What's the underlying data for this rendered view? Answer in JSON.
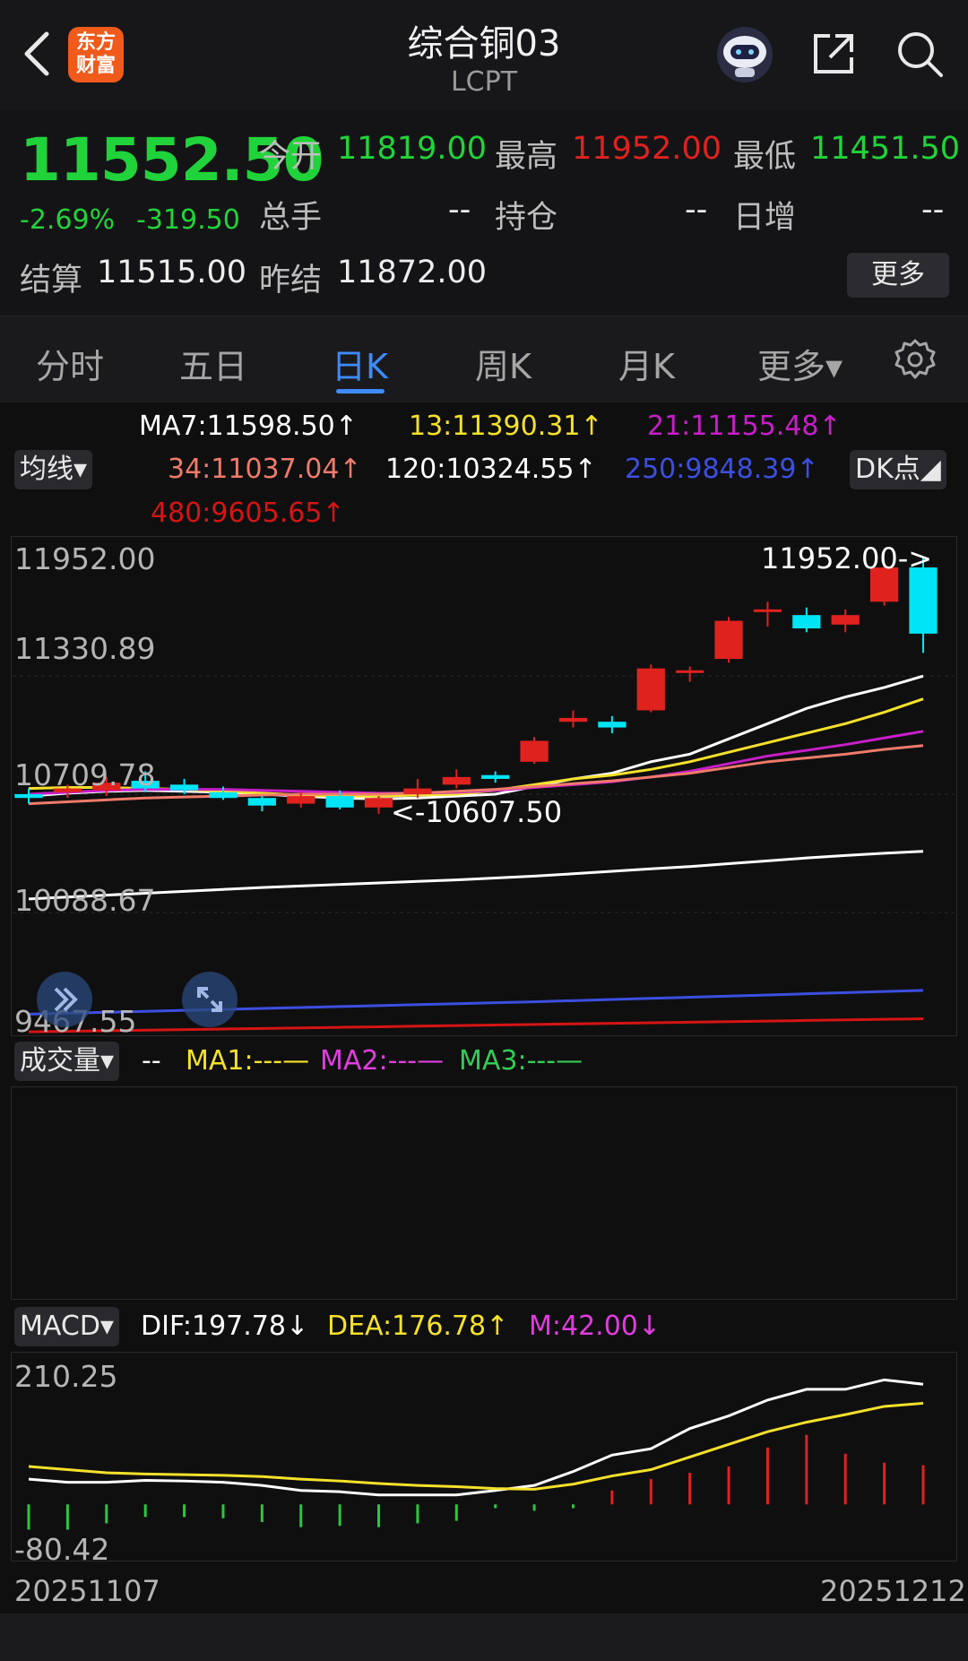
{
  "header": {
    "logo_top": "东方",
    "logo_bottom": "财富",
    "title": "综合铜03",
    "subtitle": "LCPT"
  },
  "quote": {
    "price": "11552.50",
    "change_pct": "-2.69%",
    "change_abs": "-319.50",
    "open_label": "今开",
    "open": "11819.00",
    "high_label": "最高",
    "high": "11952.00",
    "low_label": "最低",
    "low": "11451.50",
    "volume_label": "总手",
    "volume": "--",
    "oi_label": "持仓",
    "oi": "--",
    "daily_inc_label": "日增",
    "daily_inc": "--",
    "settle_label": "结算",
    "settle": "11515.00",
    "prev_settle_label": "昨结",
    "prev_settle": "11872.00",
    "more_label": "更多"
  },
  "tabs": [
    "分时",
    "五日",
    "日K",
    "周K",
    "月K",
    "更多▾"
  ],
  "active_tab": "日K",
  "ma_legend": {
    "ma7": "MA7:11598.50↑",
    "ma13": "13:11390.31↑",
    "ma21": "21:11155.48↑",
    "ma34": "34:11037.04↑",
    "ma120": "120:10324.55↑",
    "ma250": "250:9848.39↑",
    "ma480": "480:9605.65↑",
    "indicator_select": "均线▾",
    "dk_label": "DK点◢"
  },
  "colors": {
    "up": "#e0221f",
    "down": "#00e5f5",
    "ma7": "#ffffff",
    "ma13": "#f5e12a",
    "ma21": "#c81ec8",
    "ma34": "#f07a6a",
    "ma120": "#ffffff",
    "ma250": "#3c4fe0",
    "ma480": "#d61414",
    "dif": "#ffffff",
    "dea": "#f5e12a",
    "m": "#e23ce0"
  },
  "price_axis": [
    "11952.00",
    "11330.89",
    "10709.78",
    "10088.67",
    "9467.55"
  ],
  "annotations": {
    "high_marker": "11952.00->",
    "low_marker": "<-10607.50"
  },
  "volume_legend": {
    "select": "成交量▾",
    "dash": "--",
    "ma1": "MA1:---—",
    "ma2": "MA2:---—",
    "ma3": "MA3:---—"
  },
  "macd_legend": {
    "select": "MACD▾",
    "dif": "DIF:197.78↓",
    "dea": "DEA:176.78↑",
    "m": "M:42.00↓"
  },
  "macd_axis": [
    "210.25",
    "-80.42"
  ],
  "date_axis": {
    "start": "20251107",
    "end": "20251212"
  },
  "chart_data": {
    "type": "candlestick",
    "x_start": "20251107",
    "x_end": "20251212",
    "ylim": [
      9467.55,
      11952.0
    ],
    "candles": [
      {
        "o": 10710,
        "h": 10740,
        "l": 10660,
        "c": 10690
      },
      {
        "o": 10720,
        "h": 10760,
        "l": 10690,
        "c": 10740
      },
      {
        "o": 10730,
        "h": 10800,
        "l": 10700,
        "c": 10770
      },
      {
        "o": 10780,
        "h": 10830,
        "l": 10720,
        "c": 10740
      },
      {
        "o": 10760,
        "h": 10790,
        "l": 10710,
        "c": 10730
      },
      {
        "o": 10720,
        "h": 10750,
        "l": 10680,
        "c": 10690
      },
      {
        "o": 10690,
        "h": 10700,
        "l": 10620,
        "c": 10650
      },
      {
        "o": 10660,
        "h": 10720,
        "l": 10640,
        "c": 10700
      },
      {
        "o": 10700,
        "h": 10730,
        "l": 10630,
        "c": 10640
      },
      {
        "o": 10640,
        "h": 10700,
        "l": 10607.5,
        "c": 10690
      },
      {
        "o": 10710,
        "h": 10790,
        "l": 10690,
        "c": 10740
      },
      {
        "o": 10760,
        "h": 10840,
        "l": 10740,
        "c": 10800
      },
      {
        "o": 10810,
        "h": 10830,
        "l": 10770,
        "c": 10790
      },
      {
        "o": 10880,
        "h": 11010,
        "l": 10870,
        "c": 10990
      },
      {
        "o": 11090,
        "h": 11150,
        "l": 11060,
        "c": 11110
      },
      {
        "o": 11090,
        "h": 11120,
        "l": 11030,
        "c": 11060
      },
      {
        "o": 11150,
        "h": 11390,
        "l": 11140,
        "c": 11370
      },
      {
        "o": 11360,
        "h": 11380,
        "l": 11300,
        "c": 11360
      },
      {
        "o": 11420,
        "h": 11640,
        "l": 11400,
        "c": 11620
      },
      {
        "o": 11680,
        "h": 11720,
        "l": 11590,
        "c": 11680
      },
      {
        "o": 11650,
        "h": 11690,
        "l": 11560,
        "c": 11580
      },
      {
        "o": 11600,
        "h": 11680,
        "l": 11560,
        "c": 11650
      },
      {
        "o": 11720,
        "h": 11920,
        "l": 11700,
        "c": 11900
      },
      {
        "o": 11900,
        "h": 11952,
        "l": 11451.5,
        "c": 11552.5
      }
    ],
    "series": [
      {
        "name": "MA7",
        "values": [
          10700,
          10715,
          10725,
          10730,
          10725,
          10720,
          10710,
          10700,
          10690,
          10685,
          10690,
          10700,
          10710,
          10750,
          10790,
          10820,
          10880,
          10920,
          11000,
          11080,
          11160,
          11220,
          11270,
          11330
        ]
      },
      {
        "name": "MA13",
        "values": [
          10740,
          10745,
          10745,
          10740,
          10735,
          10725,
          10715,
          10705,
          10700,
          10700,
          10705,
          10710,
          10730,
          10760,
          10790,
          10810,
          10840,
          10880,
          10930,
          10980,
          11030,
          11080,
          11140,
          11210
        ]
      },
      {
        "name": "MA21",
        "values": [
          10710,
          10720,
          10730,
          10735,
          10735,
          10735,
          10730,
          10725,
          10720,
          10715,
          10715,
          10720,
          10730,
          10745,
          10760,
          10775,
          10800,
          10830,
          10870,
          10910,
          10940,
          10970,
          11005,
          11040
        ]
      },
      {
        "name": "MA34",
        "values": [
          10660,
          10670,
          10680,
          10690,
          10695,
          10700,
          10705,
          10710,
          10710,
          10710,
          10715,
          10725,
          10735,
          10750,
          10765,
          10780,
          10800,
          10820,
          10850,
          10880,
          10900,
          10920,
          10945,
          10965
        ]
      },
      {
        "name": "MA120",
        "values": [
          10160,
          10170,
          10180,
          10190,
          10200,
          10210,
          10220,
          10228,
          10236,
          10244,
          10252,
          10260,
          10270,
          10280,
          10292,
          10305,
          10318,
          10330,
          10345,
          10360,
          10375,
          10388,
          10400,
          10410
        ]
      },
      {
        "name": "MA250",
        "values": [
          9555,
          9560,
          9565,
          9570,
          9575,
          9580,
          9585,
          9590,
          9595,
          9600,
          9605,
          9610,
          9615,
          9620,
          9626,
          9632,
          9638,
          9644,
          9650,
          9656,
          9662,
          9668,
          9674,
          9680
        ]
      },
      {
        "name": "MA480",
        "values": [
          9462,
          9465,
          9468,
          9471,
          9474,
          9477,
          9480,
          9483,
          9486,
          9489,
          9492,
          9495,
          9498,
          9501,
          9504,
          9507,
          9510,
          9513,
          9516,
          9519,
          9522,
          9525,
          9528,
          9531
        ]
      }
    ],
    "macd": {
      "ylim": [
        -80.42,
        210.25
      ],
      "dif": [
        40,
        35,
        35,
        38,
        37,
        35,
        30,
        22,
        20,
        15,
        15,
        15,
        22,
        30,
        52,
        78,
        88,
        120,
        140,
        165,
        182,
        182,
        197,
        190
      ],
      "dea": [
        60,
        55,
        50,
        48,
        47,
        46,
        44,
        40,
        37,
        33,
        30,
        28,
        25,
        24,
        32,
        45,
        55,
        75,
        95,
        115,
        130,
        142,
        155,
        160
      ],
      "m": [
        -40,
        -40,
        -30,
        -20,
        -20,
        -22,
        -28,
        -36,
        -34,
        -36,
        -30,
        -26,
        -6,
        -10,
        -6,
        22,
        40,
        50,
        60,
        90,
        110,
        80,
        66,
        62
      ]
    }
  }
}
